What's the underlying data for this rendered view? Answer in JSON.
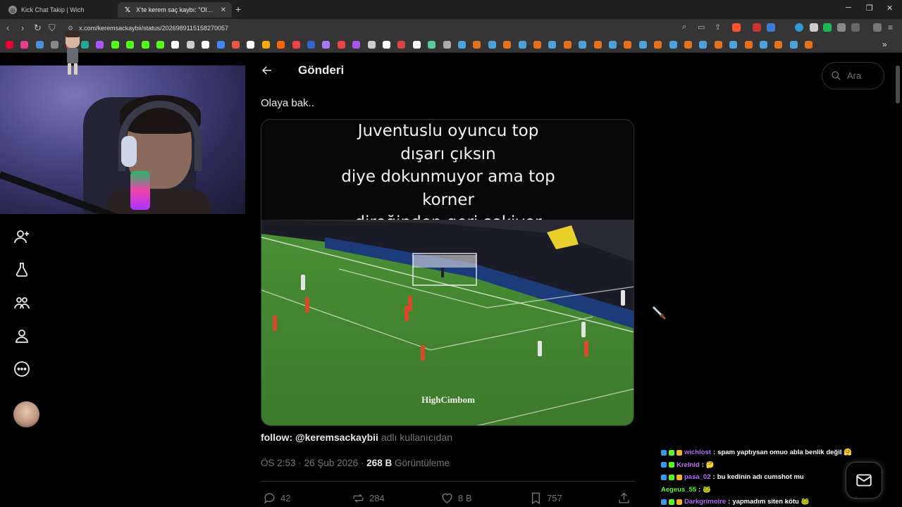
{
  "browser": {
    "tabs": [
      {
        "title": "Kick Chat Takip | Wich",
        "active": false
      },
      {
        "title": "X'te kerem saç kaybı: \"Olaya b",
        "active": true
      }
    ],
    "url": "x.com/keremsackaybii/status/2026989115158270057",
    "new_tab_icon": "plus-icon",
    "window_controls": [
      "minimize-icon",
      "maximize-icon",
      "close-icon"
    ]
  },
  "page": {
    "header_title": "Gönderi",
    "search_placeholder": "Ara",
    "post_text": "Olaya bak..",
    "media": {
      "caption_lines": [
        "Juventuslu oyuncu top",
        "dışarı çıksın",
        "diye dokunmuyor ama top",
        "korner",
        "direğinden geri sekiyor"
      ],
      "watermark": "HighCimbom"
    },
    "follow": {
      "handle": "follow: @keremsackaybii",
      "suffix": "adlı kullanıcıdan"
    },
    "meta": {
      "time": "ÖS 2:53",
      "separator": "·",
      "date": "26 Şub 2026",
      "views_count": "268 B",
      "views_label": "Görüntüleme"
    },
    "actions": {
      "replies": "42",
      "reposts": "284",
      "likes": "8 B",
      "bookmarks": "757"
    }
  },
  "left_nav_icons": [
    "follow-add-icon",
    "premium-flask-icon",
    "communities-icon",
    "profile-icon",
    "more-icon"
  ],
  "chat": [
    {
      "user": "wichlost",
      "user_color": "#b06cff",
      "message": "spam yaptıysan omuo abla benlik değil 🤗"
    },
    {
      "user": "Krelnid",
      "user_color": "#c070ff",
      "message": "🤔"
    },
    {
      "user": "pasa_02",
      "user_color": "#b06cff",
      "message": "bu kedinin adı cumshot mu"
    },
    {
      "user": "Aegeus_55",
      "user_color": "#53fc18",
      "message": "🐸"
    },
    {
      "user": "Darkgrimoire",
      "user_color": "#b06cff",
      "message": "yapmadım siten kötu 🐸"
    }
  ],
  "colors": {
    "x_background": "#000000",
    "x_text": "#e7e9ea",
    "x_muted": "#71767b",
    "kick_green": "#53fc18",
    "pitch_green": "#3f8a2c"
  }
}
